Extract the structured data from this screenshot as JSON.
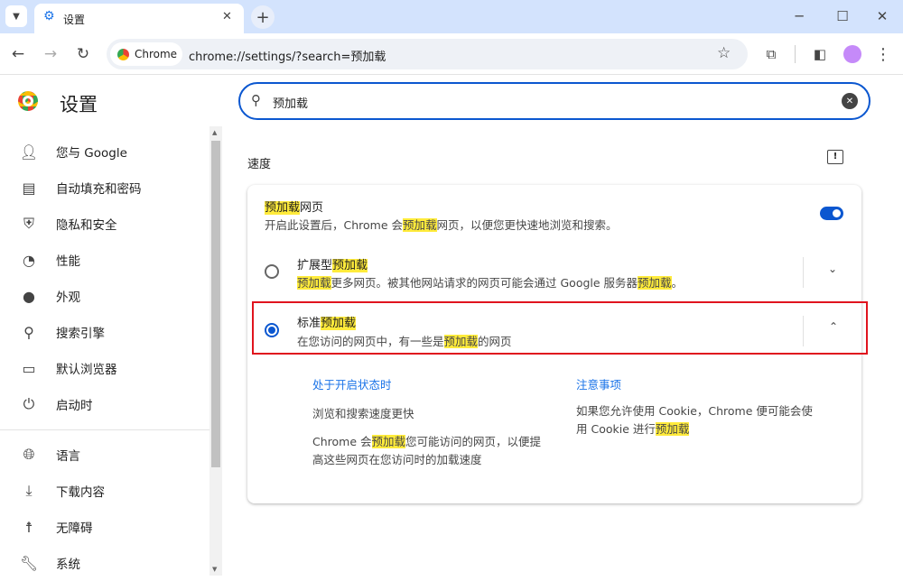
{
  "browser": {
    "tab_title": "设置",
    "url_chip": "Chrome",
    "url": "chrome://settings/?search=预加载",
    "tab_search_icon": "chevron-down-icon",
    "new_tab": "+"
  },
  "header": {
    "title": "设置"
  },
  "search": {
    "value": "预加载"
  },
  "sidebar": {
    "items": [
      {
        "label": "您与 Google",
        "icon": "person-icon"
      },
      {
        "label": "自动填充和密码",
        "icon": "clipboard-icon"
      },
      {
        "label": "隐私和安全",
        "icon": "shield-icon"
      },
      {
        "label": "性能",
        "icon": "gauge-icon"
      },
      {
        "label": "外观",
        "icon": "palette-icon"
      },
      {
        "label": "搜索引擎",
        "icon": "search-icon"
      },
      {
        "label": "默认浏览器",
        "icon": "browser-icon"
      },
      {
        "label": "启动时",
        "icon": "power-icon"
      },
      {
        "label": "语言",
        "icon": "globe-icon"
      },
      {
        "label": "下载内容",
        "icon": "download-icon"
      },
      {
        "label": "无障碍",
        "icon": "accessibility-icon"
      },
      {
        "label": "系统",
        "icon": "wrench-icon"
      }
    ]
  },
  "section": {
    "title": "速度"
  },
  "preload": {
    "title": [
      "预加载",
      "网页"
    ],
    "desc": [
      "开启此设置后，Chrome 会",
      "预加载",
      "网页，以便您更快速地浏览和搜索。"
    ],
    "enabled": true
  },
  "extended": {
    "title": [
      "扩展型",
      "预加载"
    ],
    "desc": [
      "预加载",
      "更多网页。被其他网站请求的网页可能会通过 Google 服务器",
      "预加载",
      "。"
    ],
    "selected": false
  },
  "standard": {
    "title": [
      "标准",
      "预加载"
    ],
    "desc": [
      "在您访问的网页中，有一些是",
      "预加载",
      "的网页"
    ],
    "selected": true,
    "expanded": true
  },
  "details": {
    "left_heading": "处于开启状态时",
    "left_p1": "浏览和搜索速度更快",
    "left_p2": [
      "Chrome 会",
      "预加载",
      "您可能访问的网页，以便提",
      "高这些网页在您访问时的加载速度"
    ],
    "right_heading": "注意事项",
    "right_p1": [
      "如果您允许使用 Cookie，Chrome 便可能会使",
      "用 Cookie 进行",
      "预加载"
    ]
  },
  "colors": {
    "accent": "#0b57d0",
    "highlight": "#ffeb3b",
    "annotation_box": "#e0141e"
  }
}
